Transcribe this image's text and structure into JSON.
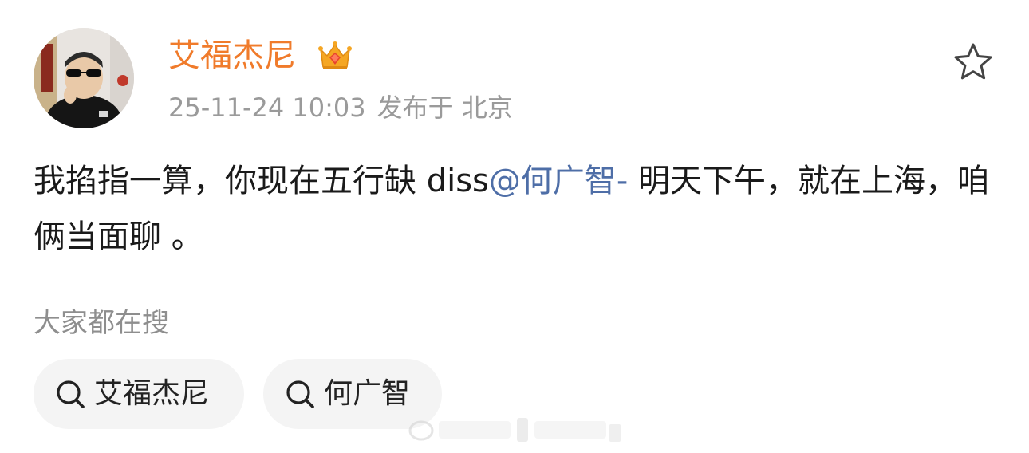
{
  "post": {
    "username": "艾福杰尼",
    "badge_icon": "crown-icon",
    "timestamp": "25-11-24 10:03",
    "location": "发布于 北京",
    "favorite_icon": "star-icon",
    "text_part1": "我掐指一算，你现在五行缺 diss",
    "mention": "@何广智-",
    "text_part2": " 明天下午，就在上海，咱俩当面聊 。"
  },
  "search": {
    "label": "大家都在搜",
    "chips": [
      {
        "icon": "search-icon",
        "text": "艾福杰尼"
      },
      {
        "icon": "search-icon",
        "text": "何广智"
      }
    ]
  },
  "colors": {
    "username": "#f07b2b",
    "mention": "#4e6ea7",
    "meta": "#9a9a9a",
    "chip_bg": "#f4f4f4"
  }
}
